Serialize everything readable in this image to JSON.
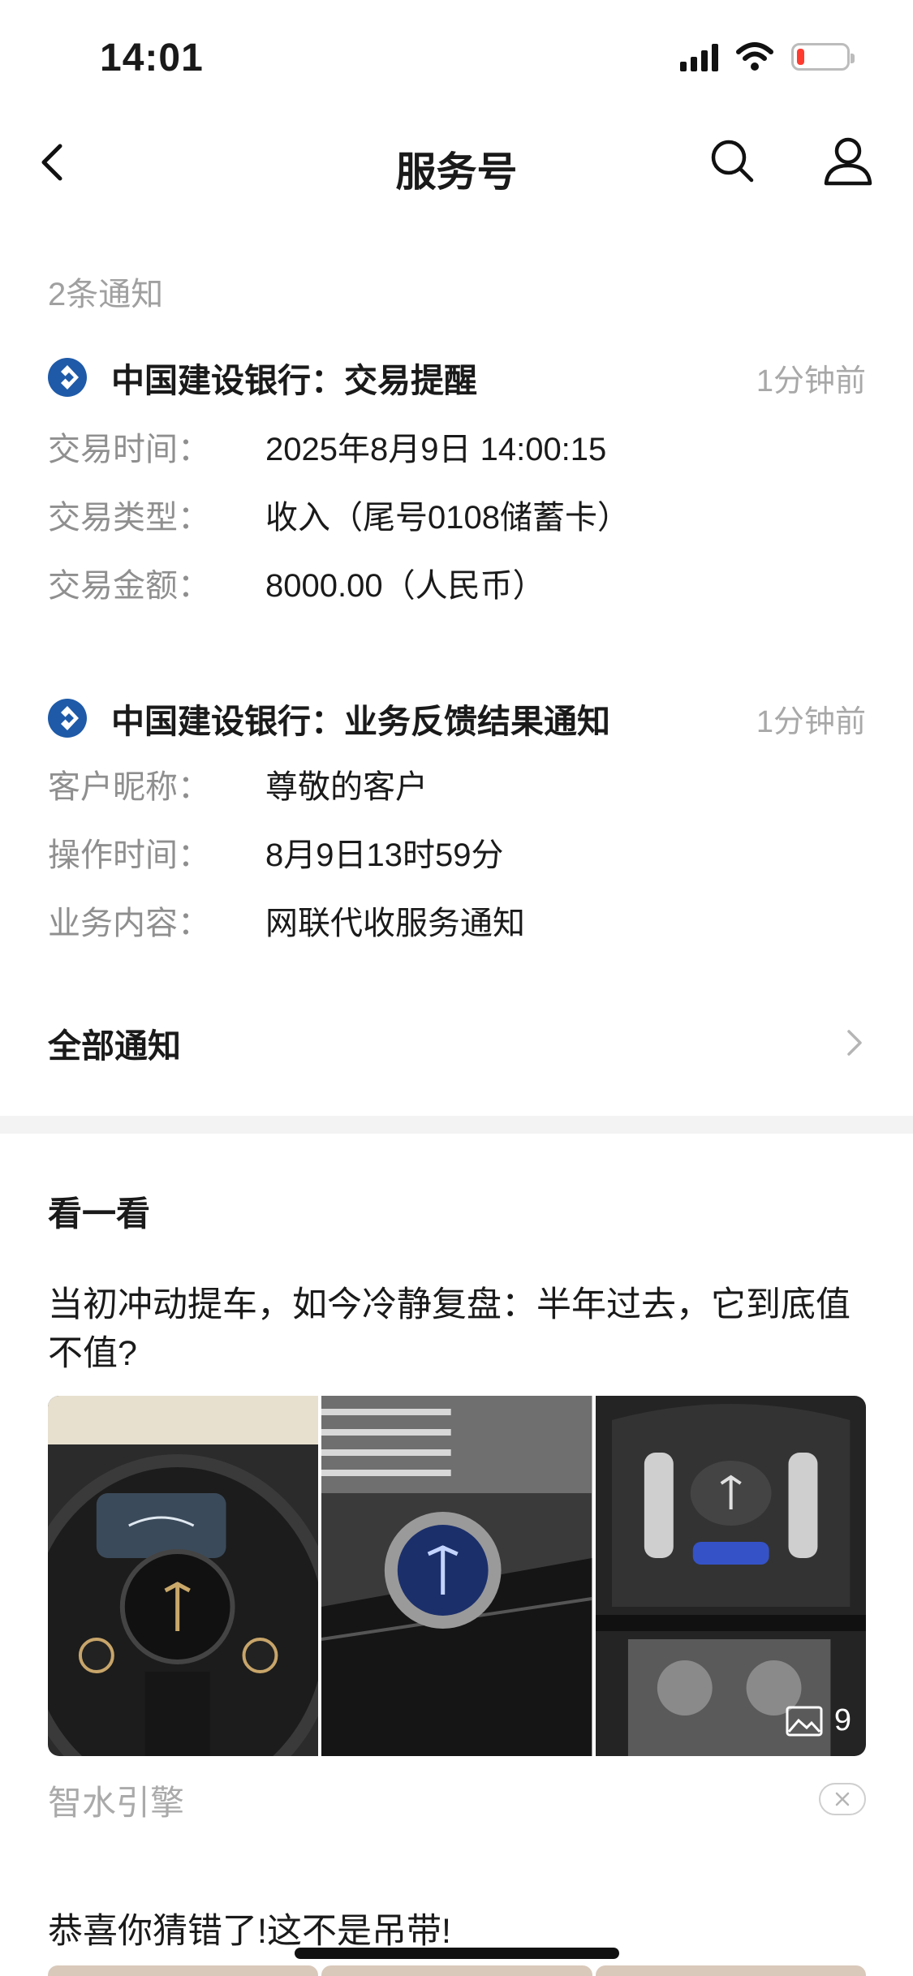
{
  "status_bar": {
    "time": "14:01",
    "battery_level": 0.15,
    "battery_color": "#ff3b30"
  },
  "nav": {
    "title": "服务号",
    "icons": [
      "back-chevron-icon",
      "search-icon",
      "profile-icon"
    ]
  },
  "notification_count": "2条通知",
  "notifications": [
    {
      "title": "中国建设银行：交易提醒",
      "time": "1分钟前",
      "rows": [
        {
          "label": "交易时间：",
          "value": "2025年8月9日 14:00:15"
        },
        {
          "label": "交易类型：",
          "value": "收入（尾号0108储蓄卡）"
        },
        {
          "label": "交易金额：",
          "value": "8000.00（人民币）"
        }
      ]
    },
    {
      "title": "中国建设银行：业务反馈结果通知",
      "time": "1分钟前",
      "rows": [
        {
          "label": "客户昵称：",
          "value": "尊敬的客户"
        },
        {
          "label": "操作时间：",
          "value": "8月9日13时59分"
        },
        {
          "label": "业务内容：",
          "value": "网联代收服务通知"
        }
      ]
    }
  ],
  "all_notifications": "全部通知",
  "discover": {
    "title": "看一看",
    "article": {
      "title": "当初冲动提车，如今冷静复盘：半年过去，它到底值不值?",
      "image_count": "9",
      "source": "智水引擎"
    },
    "article2": {
      "title": "恭喜你猜错了!这不是吊带!"
    }
  },
  "colors": {
    "brand_blue": "#1e5aa8",
    "muted_text": "#8f8f8f",
    "time_text": "#a8a8a8"
  }
}
